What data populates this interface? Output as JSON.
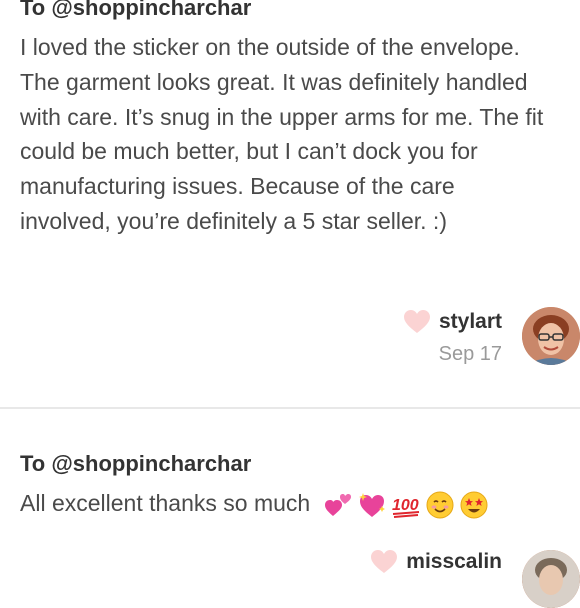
{
  "reviews": [
    {
      "to": "To @shoppincharchar",
      "body": "I loved the sticker on the outside of the envelope. The garment looks great. It was definitely handled with care. It’s snug in the upper arms for me. The fit could be much better, but I can’t dock you for manufacturing issues. Because of the care involved, you’re definitely a 5 star seller. :)",
      "username": "stylart",
      "date": "Sep 17"
    },
    {
      "to": "To @shoppincharchar",
      "body": "All excellent thanks so much",
      "emojis": [
        "two-hearts-icon",
        "sparkling-heart-icon",
        "hundred-points-icon",
        "smiling-face-icon",
        "star-struck-icon"
      ],
      "username": "misscalin"
    }
  ],
  "colors": {
    "heart": "#fbd3d3",
    "divider": "#e8e8e8",
    "date": "#9a9a9a"
  }
}
